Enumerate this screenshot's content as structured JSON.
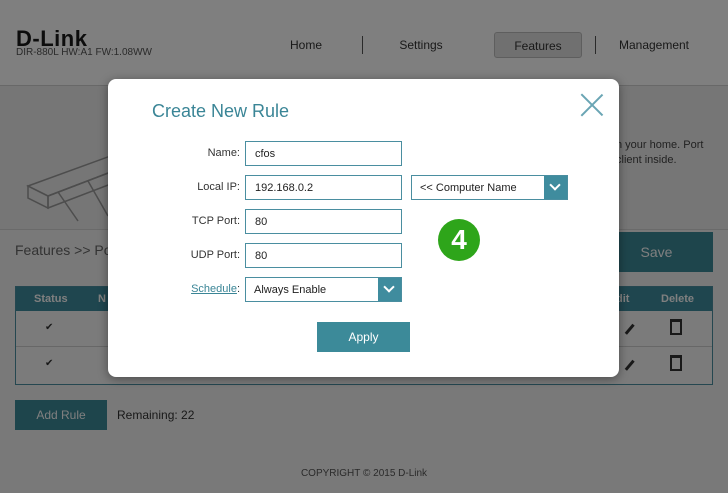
{
  "brand": {
    "logo": "D-Link",
    "model_info": "DIR-880L   HW:A1   FW:1.08WW"
  },
  "nav": {
    "home": "Home",
    "settings": "Settings",
    "features": "Features",
    "management": "Management"
  },
  "hero": {
    "text_line1": "n your home. Port",
    "text_line2": "client inside."
  },
  "breadcrumb": "Features >> Po",
  "save_label": "Save",
  "table": {
    "status_header": "Status",
    "name_header_partial": "N",
    "edit_header_partial": "dit",
    "delete_header": "Delete"
  },
  "add_rule_label": "Add Rule",
  "remaining": "Remaining: 22",
  "copyright": "COPYRIGHT © 2015 D-Link",
  "modal": {
    "title": "Create New Rule",
    "name_label": "Name:",
    "name_value": "cfos",
    "local_ip_label": "Local IP:",
    "local_ip_value": "192.168.0.2",
    "computer_select": "<< Computer Name",
    "tcp_label": "TCP Port:",
    "tcp_value": "80",
    "udp_label": "UDP Port:",
    "udp_value": "80",
    "schedule_label": "Schedule",
    "schedule_colon": ":",
    "schedule_value": "Always Enable",
    "apply_label": "Apply",
    "step_number": "4"
  },
  "colors": {
    "accent": "#3c8a99",
    "title": "#3a8596",
    "badge": "#2ea51a"
  }
}
